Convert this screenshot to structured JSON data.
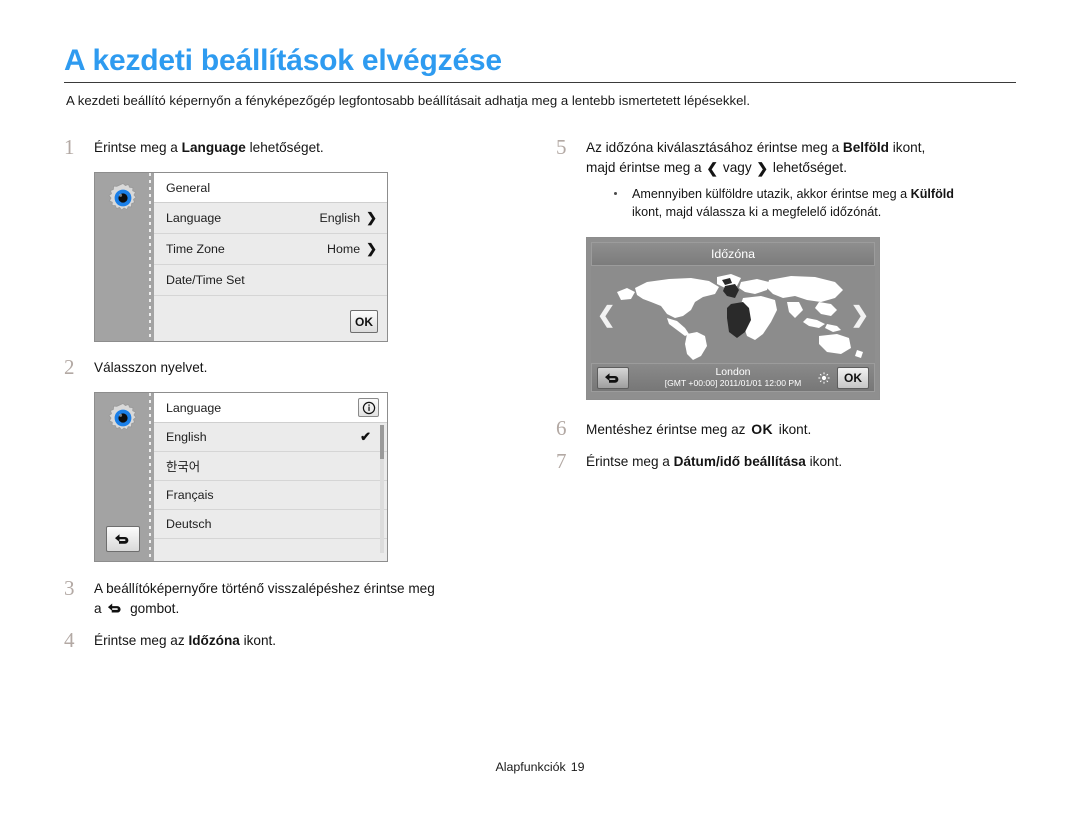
{
  "page": {
    "title": "A kezdeti beállítások elvégzése",
    "intro": "A kezdeti beállító képernyőn a fényképezőgép legfontosabb beállításait adhatja meg a lentebb ismertetett lépésekkel.",
    "footer_label": "Alapfunkciók",
    "footer_page": "19",
    "accent_color": "#2e9bf0",
    "step_number_color": "#b3a9a4"
  },
  "steps": {
    "s1": {
      "num": "1",
      "text_before": "Érintse meg a ",
      "bold": "Language",
      "text_after": " lehetőséget."
    },
    "s2": {
      "num": "2",
      "text": "Válasszon nyelvet."
    },
    "s3": {
      "num": "3",
      "line1": "A beállítóképernyőre történő visszalépéshez érintse meg",
      "line2_before": "a ",
      "line2_icon": "back-arrow-icon",
      "line2_after": " gombot."
    },
    "s4": {
      "num": "4",
      "text_before": "Érintse meg az ",
      "bold": "Időzóna",
      "text_after": " ikont."
    },
    "s5": {
      "num": "5",
      "p1_a": "Az időzóna kiválasztásához érintse meg a ",
      "p1_bold": "Belföld",
      "p1_b": " ikont,",
      "p2_a": "majd érintse meg a ",
      "p2_left": "❮",
      "p2_mid": " vagy ",
      "p2_right": "❯",
      "p2_b": " lehetőséget.",
      "bullet_a": "Amennyiben külföldre utazik, akkor érintse meg a ",
      "bullet_bold": "Külföld",
      "bullet_b": "ikont, majd válassza ki a megfelelő időzónát."
    },
    "s6": {
      "num": "6",
      "text_before": "Mentéshez érintse meg az ",
      "ok": "OK",
      "text_after": " ikont."
    },
    "s7": {
      "num": "7",
      "text_before": "Érintse meg a ",
      "bold": "Dátum/idő beállítása",
      "text_after": " ikont."
    }
  },
  "general_screen": {
    "header_title": "General",
    "rows": [
      {
        "label": "Language",
        "value": "English",
        "chevron": "❯"
      },
      {
        "label": "Time Zone",
        "value": "Home",
        "chevron": "❯"
      },
      {
        "label": "Date/Time Set",
        "value": "",
        "chevron": ""
      }
    ],
    "ok_label": "OK"
  },
  "language_screen": {
    "header_title": "Language",
    "info_glyph": "ⓘ",
    "items": [
      {
        "label": "English",
        "checked": true,
        "check_glyph": "✔"
      },
      {
        "label": "한국어",
        "checked": false,
        "check_glyph": ""
      },
      {
        "label": "Français",
        "checked": false,
        "check_glyph": ""
      },
      {
        "label": "Deutsch",
        "checked": false,
        "check_glyph": ""
      }
    ]
  },
  "timezone_screen": {
    "title": "Időzóna",
    "left_arrow": "❮",
    "right_arrow": "❯",
    "city": "London",
    "stamp": "[GMT +00:00] 2011/01/01 12:00 PM",
    "ok_label": "OK"
  }
}
